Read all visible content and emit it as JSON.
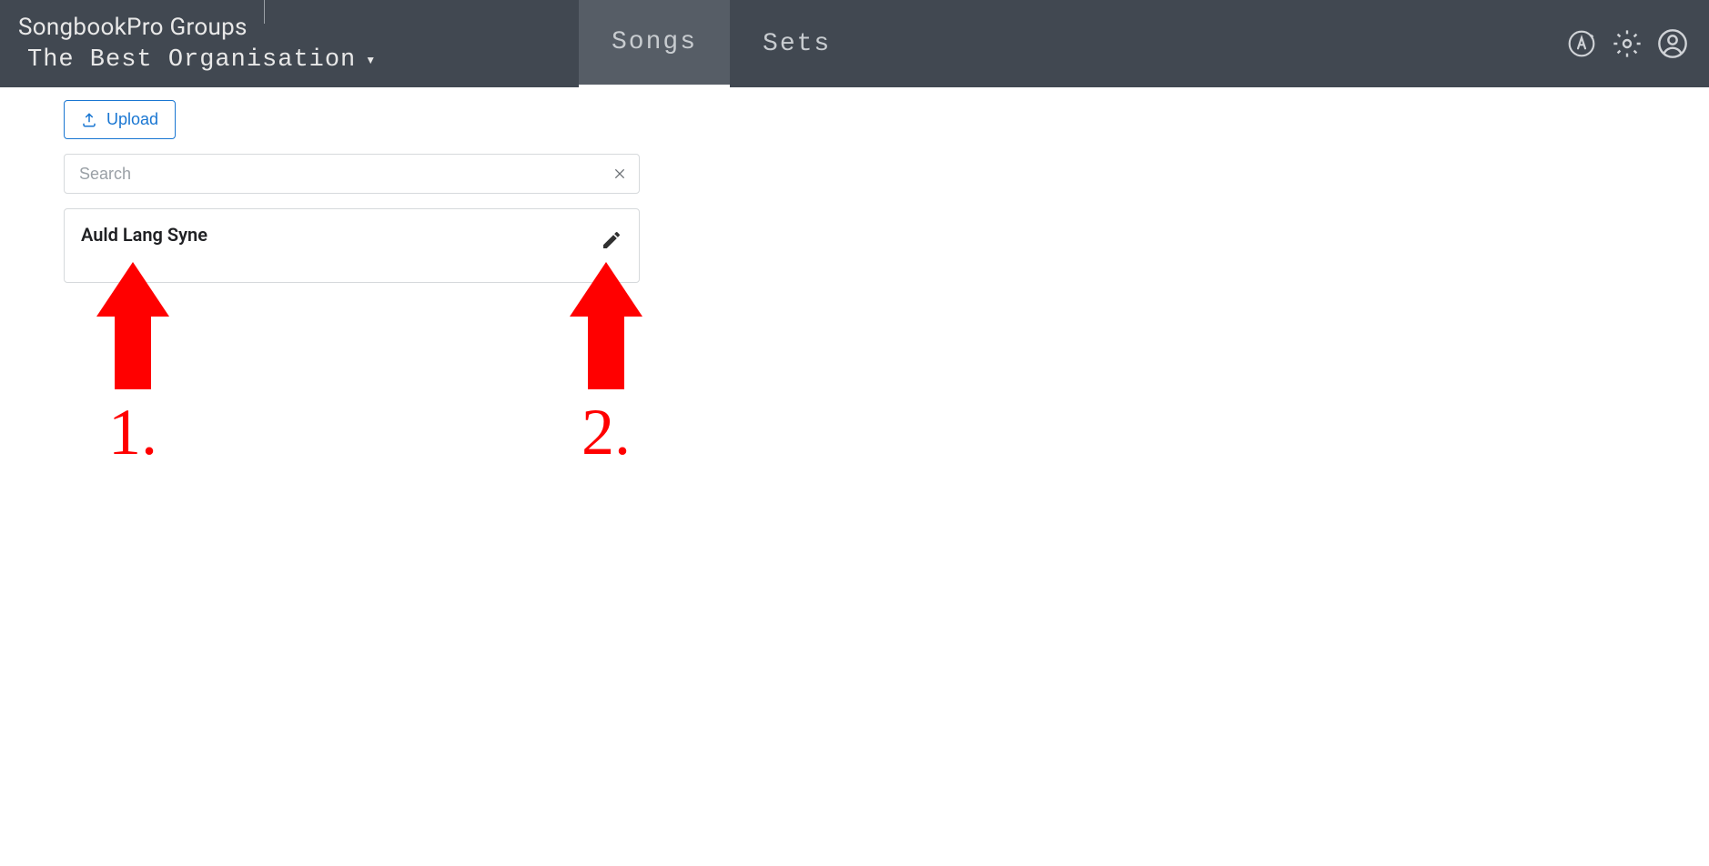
{
  "header": {
    "app_title": "SongbookPro Groups",
    "org_name": "The Best Organisation"
  },
  "tabs": [
    {
      "label": "Songs",
      "active": true
    },
    {
      "label": "Sets",
      "active": false
    }
  ],
  "upload": {
    "label": "Upload"
  },
  "search": {
    "placeholder": "Search",
    "value": ""
  },
  "songs": [
    {
      "title": "Auld Lang Syne"
    }
  ],
  "annotations": [
    {
      "label": "1."
    },
    {
      "label": "2."
    }
  ]
}
